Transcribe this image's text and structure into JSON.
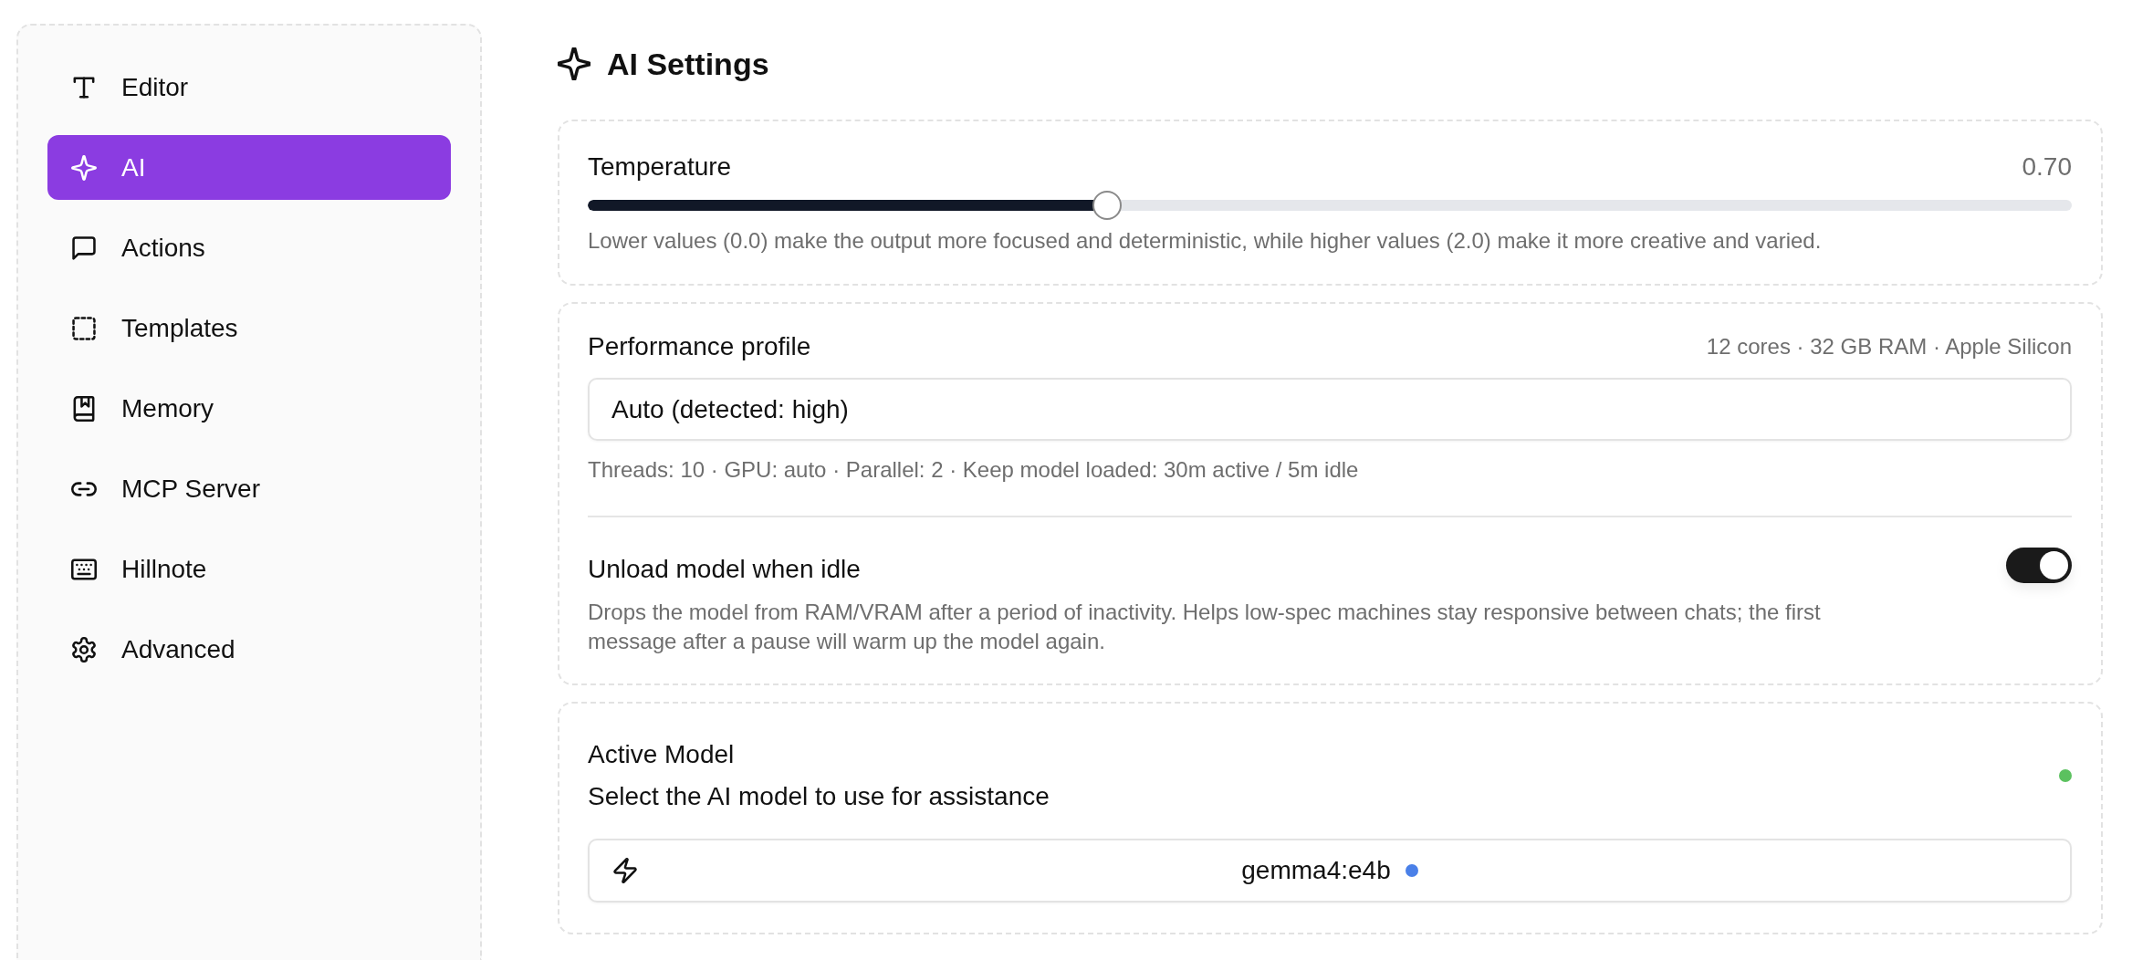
{
  "sidebar": {
    "items": [
      {
        "label": "Editor",
        "selected": false
      },
      {
        "label": "AI",
        "selected": true
      },
      {
        "label": "Actions",
        "selected": false
      },
      {
        "label": "Templates",
        "selected": false
      },
      {
        "label": "Memory",
        "selected": false
      },
      {
        "label": "MCP Server",
        "selected": false
      },
      {
        "label": "Hillnote",
        "selected": false
      },
      {
        "label": "Advanced",
        "selected": false
      }
    ]
  },
  "page": {
    "title": "AI Settings"
  },
  "temperature": {
    "label": "Temperature",
    "reading": "0.70",
    "level": 0.35,
    "description": "Lower values (0.0) make the output more focused and deterministic, while higher values (2.0) make it more creative and varied."
  },
  "performance": {
    "label": "Performance profile",
    "system_info": "12 cores · 32 GB RAM · Apple Silicon",
    "profile_select": {
      "value": "Auto (detected: high)"
    },
    "details": "Threads: 10 · GPU: auto · Parallel: 2 · Keep model loaded: 30m active / 5m idle",
    "unload_when_idle": {
      "label": "Unload model when idle",
      "on": true,
      "description": "Drops the model from RAM/VRAM after a period of inactivity. Helps low-spec machines stay responsive between chats; the first message after a pause will warm up the model again."
    }
  },
  "active_model": {
    "title": "Active Model",
    "subtitle": "Select the AI model to use for assistance",
    "status_dot": {
      "color": "#5bc15f"
    },
    "model_select": {
      "value": "gemma4:e4b",
      "indicator": {
        "color": "#4a80e8"
      }
    }
  }
}
